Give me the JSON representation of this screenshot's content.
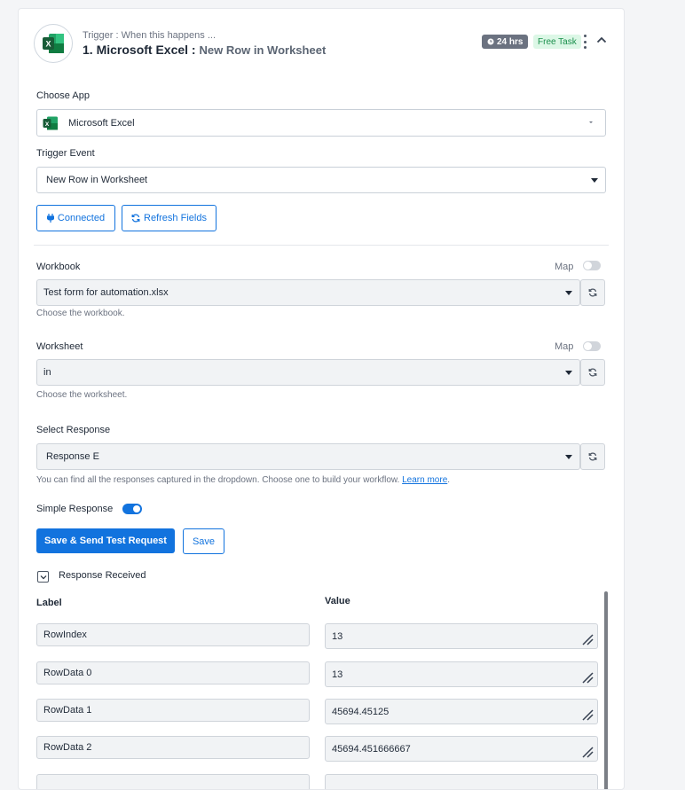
{
  "header": {
    "subtitle": "Trigger : When this happens ...",
    "step_title": "1. Microsoft Excel :",
    "event_name": "New Row in Worksheet",
    "time_badge": "24 hrs",
    "task_badge": "Free Task"
  },
  "choose_app": {
    "label": "Choose App",
    "value": "Microsoft Excel"
  },
  "trigger_event": {
    "label": "Trigger Event",
    "value": "New Row in Worksheet"
  },
  "buttons": {
    "connected": "Connected",
    "refresh_fields": "Refresh Fields"
  },
  "workbook": {
    "label": "Workbook",
    "map_label": "Map",
    "value": "Test form for automation.xlsx",
    "hint": "Choose the workbook."
  },
  "worksheet": {
    "label": "Worksheet",
    "map_label": "Map",
    "value": "in",
    "hint": "Choose the worksheet."
  },
  "select_response": {
    "label": "Select Response",
    "value": "Response E",
    "hint": "You can find all the responses captured in the dropdown. Choose one to build your workflow.",
    "learn_more": "Learn more",
    "period": "."
  },
  "simple_response": {
    "label": "Simple Response",
    "enabled": true
  },
  "actions": {
    "save_send": "Save & Send Test Request",
    "save": "Save"
  },
  "response_received": {
    "title": "Response Received",
    "col_label": "Label",
    "col_value": "Value",
    "rows": [
      {
        "label": "RowIndex",
        "value": "13"
      },
      {
        "label": "RowData 0",
        "value": "13"
      },
      {
        "label": "RowData 1",
        "value": "45694.45125"
      },
      {
        "label": "RowData 2",
        "value": "45694.451666667"
      }
    ]
  },
  "colors": {
    "accent": "#1273de",
    "excel_green": "#1d6f42",
    "free_task_bg": "#dcf7e6"
  }
}
